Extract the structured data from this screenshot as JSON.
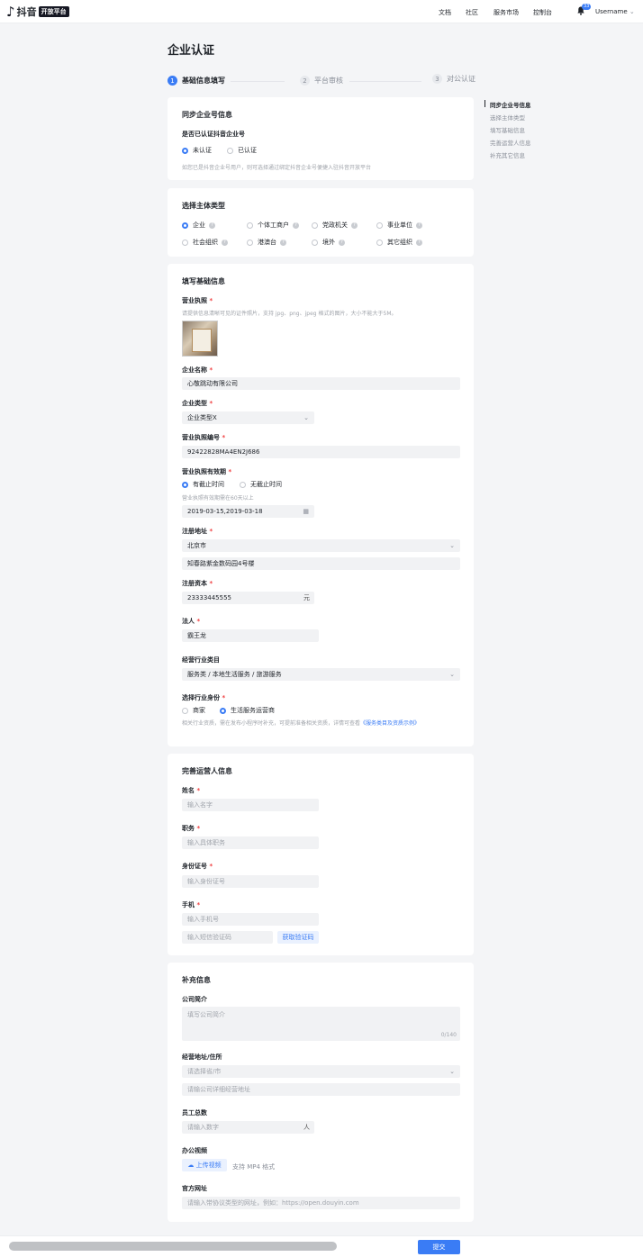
{
  "topbar": {
    "brand": "抖音",
    "brand_tag": "开放平台",
    "nav": [
      "文档",
      "社区",
      "服务市场",
      "控制台"
    ],
    "notif_count": "33",
    "username": "Username"
  },
  "page_title": "企业认证",
  "steps": [
    {
      "num": "1",
      "label": "基础信息填写"
    },
    {
      "num": "2",
      "label": "平台审核"
    },
    {
      "num": "3",
      "label": "对公认证"
    }
  ],
  "side_nav": [
    "同步企业号信息",
    "选择主体类型",
    "填写基础信息",
    "完善运营人信息",
    "补充其它信息"
  ],
  "sync": {
    "title": "同步企业号信息",
    "question": "是否已认证抖音企业号",
    "opt_no": "未认证",
    "opt_yes": "已认证",
    "hint": "如您已是抖音企业号用户，则可选择通过绑定抖音企业号便捷入驻抖音开放平台"
  },
  "entity": {
    "title": "选择主体类型",
    "options": [
      "企业",
      "个体工商户",
      "党政机关",
      "事业单位",
      "社会组织",
      "港澳台",
      "境外",
      "其它组织"
    ]
  },
  "basic": {
    "title": "填写基础信息",
    "license_label": "营业执照",
    "license_hint": "请提供信息清晰可见的证件照片，支持 jpg、png、jpeg 格式的图片，大小不能大于5M。",
    "name_label": "企业名称",
    "name_value": "心敬跳动有限公司",
    "type_label": "企业类型",
    "type_value": "企业类型X",
    "code_label": "营业执照编号",
    "code_value": "92422828MA4EN2J686",
    "validity_label": "营业执照有效期",
    "validity_opt1": "有截止时间",
    "validity_opt2": "无截止时间",
    "validity_hint": "营业执照有效期需在60天以上",
    "validity_value": "2019-03-15,2019-03-18",
    "addr_label": "注册地址",
    "addr_city": "北京市",
    "addr_detail": "知春路紫金数码园4号楼",
    "capital_label": "注册资本",
    "capital_value": "23333445555",
    "capital_unit": "元",
    "legal_label": "法人",
    "legal_value": "霸王龙",
    "industry_label": "经营行业类目",
    "industry_value": "服务类 / 本地生活服务 / 旅游服务",
    "role_label": "选择行业身份",
    "role_opt1": "商家",
    "role_opt2": "生活服务运营商",
    "role_hint": "相关行业资质，需在发布小程序时补充，可提前准备相关资质，详情可查看",
    "role_link": "《服务类目及资质示例》"
  },
  "operator": {
    "title": "完善运营人信息",
    "name_label": "姓名",
    "name_ph": "输入名字",
    "job_label": "职务",
    "job_ph": "输入具体职务",
    "id_label": "身份证号",
    "id_ph": "输入身份证号",
    "phone_label": "手机",
    "phone_ph": "输入手机号",
    "code_ph": "输入短信验证码",
    "code_btn": "获取验证码"
  },
  "extra": {
    "title": "补充信息",
    "intro_label": "公司简介",
    "intro_ph": "填写公司简介",
    "intro_count": "0/140",
    "addr_label": "经营地址/住所",
    "addr_ph": "请选择省/市",
    "addr_detail_ph": "请输公司详细经营地址",
    "staff_label": "员工总数",
    "staff_ph": "请输入数字",
    "staff_unit": "人",
    "video_label": "办公视频",
    "video_btn": "上传视频",
    "video_hint": "支持 MP4 格式",
    "site_label": "官方网址",
    "site_ph": "请输入带协议类型的网址，例如：https://open.douyin.com"
  },
  "submit_label": "提交",
  "colors": {
    "accent": "#3a7cf5",
    "required": "#f04142"
  }
}
